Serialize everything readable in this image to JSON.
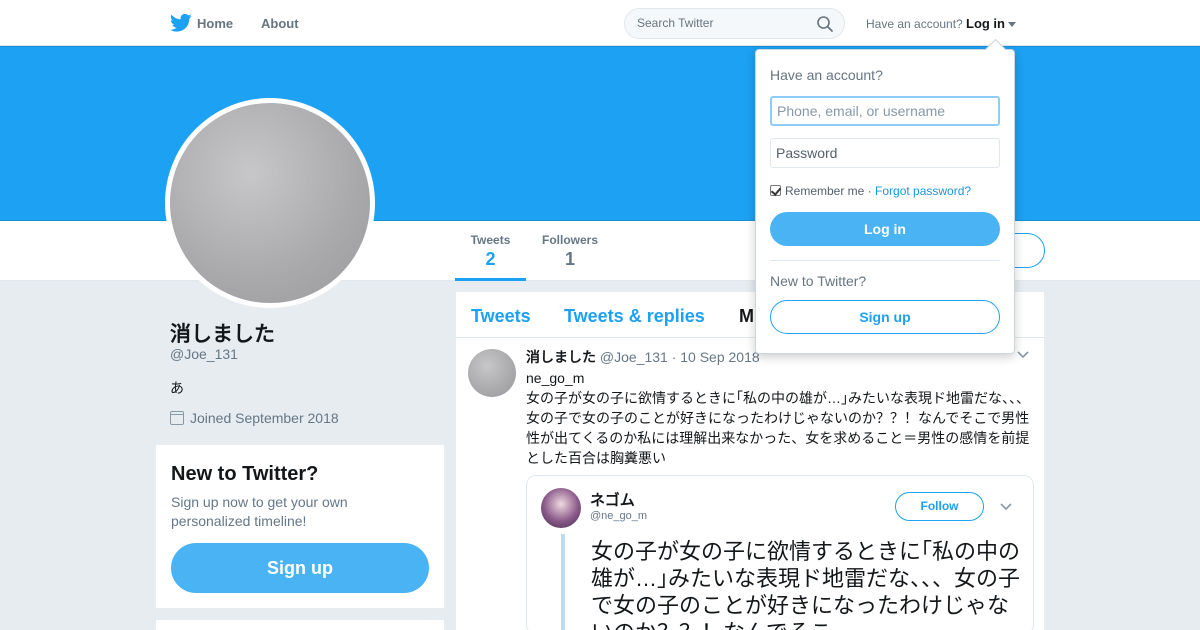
{
  "nav": {
    "home_label": "Home",
    "about_label": "About",
    "search_placeholder": "Search Twitter",
    "have_account": "Have an account?",
    "login_label": "Log in",
    "logo_icon": "twitter-bird-icon",
    "brand_color": "#1da1f2"
  },
  "profile": {
    "name": "消しました",
    "handle": "@Joe_131",
    "bio": "あ",
    "joined": "Joined September 2018"
  },
  "stats": {
    "tweets_label": "Tweets",
    "tweets_value": "2",
    "followers_label": "Followers",
    "followers_value": "1"
  },
  "signup_card": {
    "title": "New to Twitter?",
    "text": "Sign up now to get your own personalized timeline!",
    "button": "Sign up"
  },
  "timeline": {
    "tabs": [
      {
        "label": "Tweets"
      },
      {
        "label": "Tweets & replies"
      },
      {
        "label": "M"
      }
    ],
    "tweet": {
      "name": "消しました",
      "handle_date": "@Joe_131 · 10 Sep 2018",
      "reply_to": "ne_go_m",
      "text": "女の子が女の子に欲情するときに｢私の中の雄が…｣みたいな表現ド地雷だな、、、女の子で女の子のことが好きになったわけじゃないのか？？！なんでそこで男性性が出てくるのか私には理解出来なかった、女を求めること＝男性の感情を前提とした百合は胸糞悪い",
      "quote": {
        "name": "ネゴム",
        "handle": "@ne_go_m",
        "follow_label": "Follow",
        "text": "女の子が女の子に欲情するときに｢私の中の雄が…｣みたいな表現ド地雷だな、、、女の子で女の子のことが好きになったわけじゃないのか？？！なんでそこ"
      }
    }
  },
  "login_dropdown": {
    "title": "Have an account?",
    "username_placeholder": "Phone, email, or username",
    "password_placeholder": "Password",
    "remember_me": "Remember me",
    "separator": " · ",
    "forgot_password": "Forgot password?",
    "login_button": "Log in",
    "new_to_twitter": "New to Twitter?",
    "signup_button": "Sign up"
  }
}
